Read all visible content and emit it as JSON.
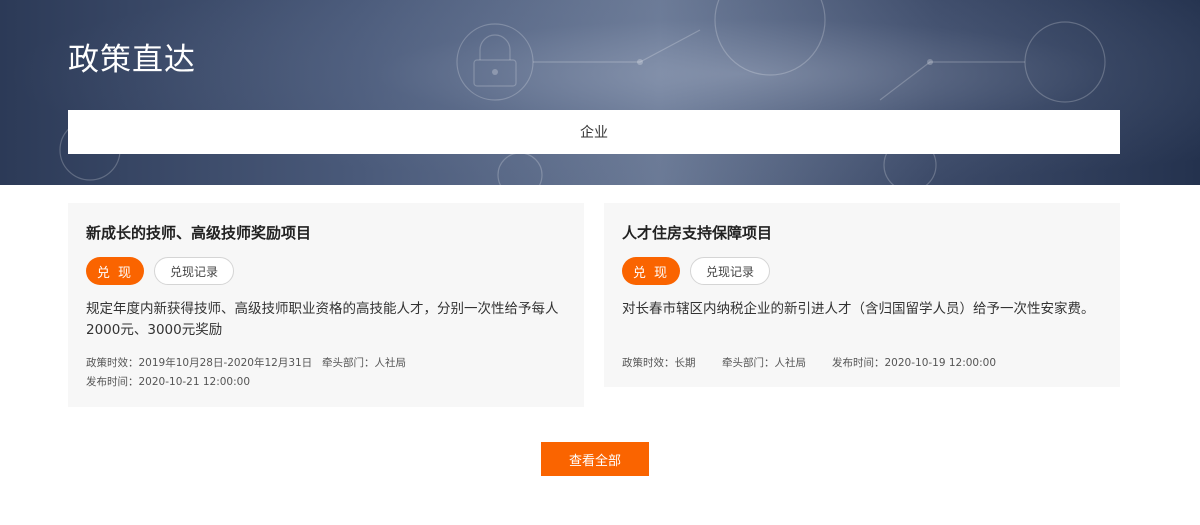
{
  "header": {
    "title": "政策直达",
    "filter_label": "企业"
  },
  "policies": [
    {
      "title": "新成长的技师、高级技师奖励项目",
      "redeem_label": "兑 现",
      "record_label": "兑现记录",
      "description": "规定年度内新获得技师、高级技师职业资格的高技能人才，分别一次性给予每人2000元、3000元奖励",
      "validity": "政策时效：2019年10月28日-2020年12月31日",
      "department": "牵头部门：人社局",
      "published": "发布时间：2020-10-21 12:00:00"
    },
    {
      "title": "人才住房支持保障项目",
      "redeem_label": "兑 现",
      "record_label": "兑现记录",
      "description": "对长春市辖区内纳税企业的新引进人才（含归国留学人员）给予一次性安家费。",
      "validity": "政策时效：长期",
      "department": "牵头部门：人社局",
      "published": "发布时间：2020-10-19 12:00:00"
    }
  ],
  "footer": {
    "view_all_label": "查看全部"
  },
  "colors": {
    "accent": "#fa6400",
    "card_bg": "#f7f7f7",
    "hero_dark": "#24324e"
  }
}
